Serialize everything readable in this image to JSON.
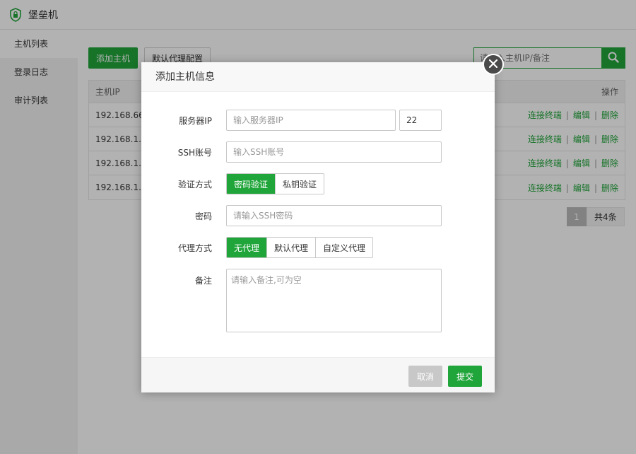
{
  "app": {
    "title": "堡垒机",
    "logo_icon": "shield-lock-icon"
  },
  "sidebar": {
    "items": [
      {
        "label": "主机列表",
        "active": true
      },
      {
        "label": "登录日志",
        "active": false
      },
      {
        "label": "审计列表",
        "active": false
      }
    ]
  },
  "toolbar": {
    "add_host_label": "添加主机",
    "default_proxy_label": "默认代理配置"
  },
  "search": {
    "placeholder": "请输入主机IP/备注",
    "icon": "search-icon"
  },
  "table": {
    "headers": {
      "ip": "主机IP",
      "ops": "操作"
    },
    "rows": [
      {
        "ip": "192.168.66."
      },
      {
        "ip": "192.168.1.1"
      },
      {
        "ip": "192.168.1.1"
      },
      {
        "ip": "192.168.1.1"
      }
    ],
    "ops": {
      "connect": "连接终端",
      "edit": "编辑",
      "delete": "删除",
      "sep": "|"
    }
  },
  "pager": {
    "current": "1",
    "total": "共4条"
  },
  "dialog": {
    "title": "添加主机信息",
    "server_ip": {
      "label": "服务器IP",
      "placeholder": "输入服务器IP",
      "port_value": "22"
    },
    "ssh_user": {
      "label": "SSH账号",
      "placeholder": "输入SSH账号"
    },
    "auth": {
      "label": "验证方式",
      "options": [
        "密码验证",
        "私钥验证"
      ],
      "selected": 0
    },
    "password": {
      "label": "密码",
      "placeholder": "请输入SSH密码"
    },
    "proxy": {
      "label": "代理方式",
      "options": [
        "无代理",
        "默认代理",
        "自定义代理"
      ],
      "selected": 0
    },
    "remark": {
      "label": "备注",
      "placeholder": "请输入备注,可为空"
    },
    "cancel_label": "取消",
    "submit_label": "提交",
    "close_icon": "close-icon"
  },
  "colors": {
    "accent": "#20a53a",
    "disabled": "#c8c8c8",
    "overlay": "rgba(0,0,0,0.3)"
  }
}
